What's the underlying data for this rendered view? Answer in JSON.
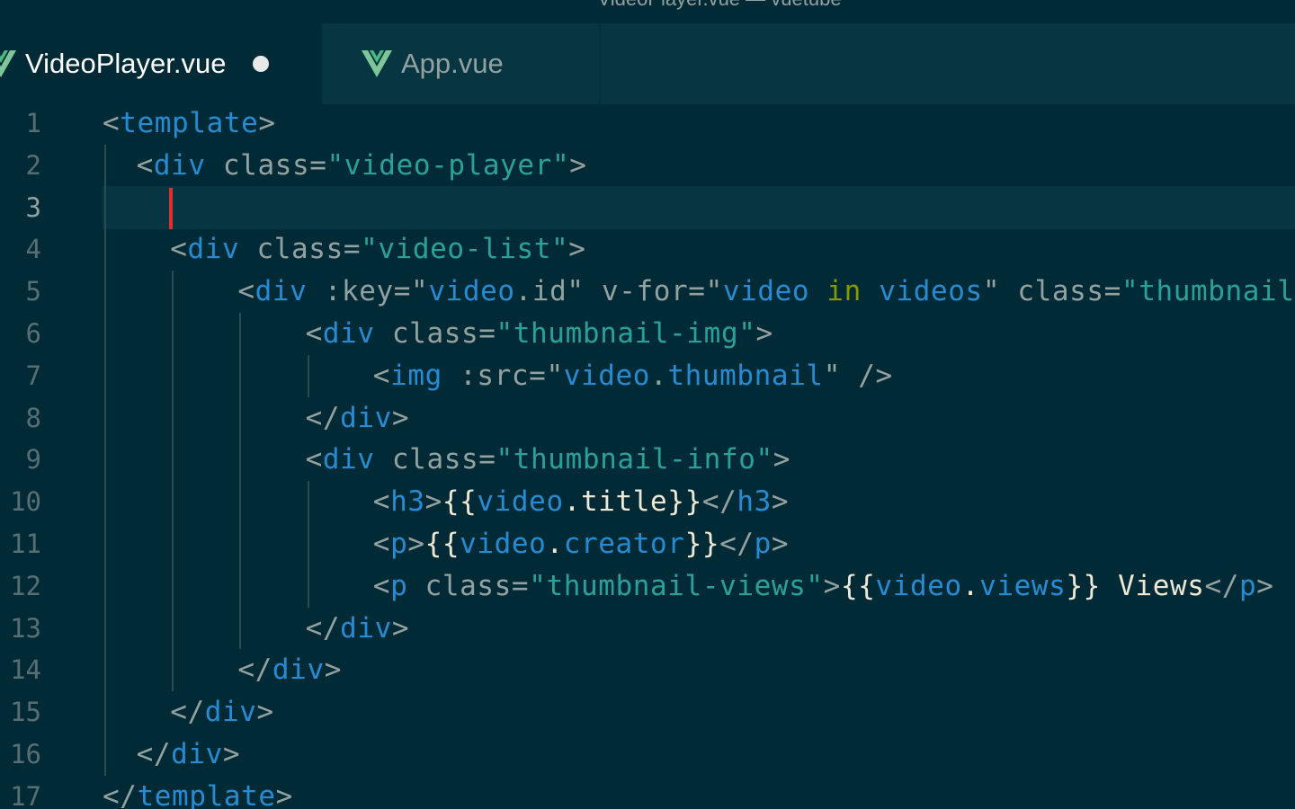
{
  "window": {
    "title": "VideoPlayer.vue — vuetube"
  },
  "tabs": [
    {
      "label": "VideoPlayer.vue",
      "icon": "vue-logo-icon",
      "active": true,
      "modified": true
    },
    {
      "label": "App.vue",
      "icon": "vue-logo-icon",
      "active": false,
      "modified": false
    }
  ],
  "colors": {
    "background": "#002b36",
    "tab_bar": "#073642",
    "current_line": "#073642",
    "cursor": "#dc322f",
    "tag": "#268bd2",
    "string": "#2aa198",
    "keyword": "#859900",
    "punctuation": "#93a1a1",
    "line_number": "#586e75"
  },
  "editor": {
    "current_line": 3,
    "line_numbers": [
      "1",
      "2",
      "3",
      "4",
      "5",
      "6",
      "7",
      "8",
      "9",
      "10",
      "11",
      "12",
      "13",
      "14",
      "15",
      "16",
      "17"
    ],
    "lines": [
      {
        "num": "1",
        "indent": 0,
        "tokens": [
          [
            "punct",
            "<"
          ],
          [
            "tag",
            "template"
          ],
          [
            "punct",
            ">"
          ]
        ]
      },
      {
        "num": "2",
        "indent": 1,
        "tokens": [
          [
            "punct",
            "<"
          ],
          [
            "tag",
            "div"
          ],
          [
            "attr",
            " class="
          ],
          [
            "str",
            "\"video-player\""
          ],
          [
            "punct",
            ">"
          ]
        ]
      },
      {
        "num": "3",
        "indent": 2,
        "tokens": []
      },
      {
        "num": "4",
        "indent": 2,
        "tokens": [
          [
            "punct",
            "<"
          ],
          [
            "tag",
            "div"
          ],
          [
            "attr",
            " class="
          ],
          [
            "str",
            "\"video-list\""
          ],
          [
            "punct",
            ">"
          ]
        ]
      },
      {
        "num": "5",
        "indent": 4,
        "tokens": [
          [
            "punct",
            "<"
          ],
          [
            "tag",
            "div"
          ],
          [
            "attr",
            " :key="
          ],
          [
            "attr",
            "\""
          ],
          [
            "var",
            "video"
          ],
          [
            "attr",
            ".id\""
          ],
          [
            "attr",
            " v-for="
          ],
          [
            "attr",
            "\""
          ],
          [
            "var",
            "video"
          ],
          [
            "kw",
            " in "
          ],
          [
            "var",
            "videos"
          ],
          [
            "attr",
            "\""
          ],
          [
            "attr",
            " class="
          ],
          [
            "str",
            "\"thumbnail\""
          ],
          [
            "punct",
            ">"
          ]
        ]
      },
      {
        "num": "6",
        "indent": 6,
        "tokens": [
          [
            "punct",
            "<"
          ],
          [
            "tag",
            "div"
          ],
          [
            "attr",
            " class="
          ],
          [
            "str",
            "\"thumbnail-img\""
          ],
          [
            "punct",
            ">"
          ]
        ]
      },
      {
        "num": "7",
        "indent": 8,
        "tokens": [
          [
            "punct",
            "<"
          ],
          [
            "tag",
            "img"
          ],
          [
            "attr",
            " :src="
          ],
          [
            "attr",
            "\""
          ],
          [
            "var",
            "video"
          ],
          [
            "attr",
            "."
          ],
          [
            "var",
            "thumbnail"
          ],
          [
            "attr",
            "\""
          ],
          [
            "punct",
            " />"
          ]
        ]
      },
      {
        "num": "8",
        "indent": 6,
        "tokens": [
          [
            "punct",
            "</"
          ],
          [
            "tag",
            "div"
          ],
          [
            "punct",
            ">"
          ]
        ]
      },
      {
        "num": "9",
        "indent": 6,
        "tokens": [
          [
            "punct",
            "<"
          ],
          [
            "tag",
            "div"
          ],
          [
            "attr",
            " class="
          ],
          [
            "str",
            "\"thumbnail-info\""
          ],
          [
            "punct",
            ">"
          ]
        ]
      },
      {
        "num": "10",
        "indent": 8,
        "tokens": [
          [
            "punct",
            "<"
          ],
          [
            "tag",
            "h3"
          ],
          [
            "punct",
            ">"
          ],
          [
            "text",
            "{{"
          ],
          [
            "var",
            "video"
          ],
          [
            "text",
            ".title}}"
          ],
          [
            "punct",
            "</"
          ],
          [
            "tag",
            "h3"
          ],
          [
            "punct",
            ">"
          ]
        ]
      },
      {
        "num": "11",
        "indent": 8,
        "tokens": [
          [
            "punct",
            "<"
          ],
          [
            "tag",
            "p"
          ],
          [
            "punct",
            ">"
          ],
          [
            "text",
            "{{"
          ],
          [
            "var",
            "video"
          ],
          [
            "text",
            "."
          ],
          [
            "var",
            "creator"
          ],
          [
            "text",
            "}}"
          ],
          [
            "punct",
            "</"
          ],
          [
            "tag",
            "p"
          ],
          [
            "punct",
            ">"
          ]
        ]
      },
      {
        "num": "12",
        "indent": 8,
        "tokens": [
          [
            "punct",
            "<"
          ],
          [
            "tag",
            "p"
          ],
          [
            "attr",
            " class="
          ],
          [
            "str",
            "\"thumbnail-views\""
          ],
          [
            "punct",
            ">"
          ],
          [
            "text",
            "{{"
          ],
          [
            "var",
            "video"
          ],
          [
            "text",
            "."
          ],
          [
            "var",
            "views"
          ],
          [
            "text",
            "}} Views"
          ],
          [
            "punct",
            "</"
          ],
          [
            "tag",
            "p"
          ],
          [
            "punct",
            ">"
          ]
        ]
      },
      {
        "num": "13",
        "indent": 6,
        "tokens": [
          [
            "punct",
            "</"
          ],
          [
            "tag",
            "div"
          ],
          [
            "punct",
            ">"
          ]
        ]
      },
      {
        "num": "14",
        "indent": 4,
        "tokens": [
          [
            "punct",
            "</"
          ],
          [
            "tag",
            "div"
          ],
          [
            "punct",
            ">"
          ]
        ]
      },
      {
        "num": "15",
        "indent": 2,
        "tokens": [
          [
            "punct",
            "</"
          ],
          [
            "tag",
            "div"
          ],
          [
            "punct",
            ">"
          ]
        ]
      },
      {
        "num": "16",
        "indent": 1,
        "tokens": [
          [
            "punct",
            "</"
          ],
          [
            "tag",
            "div"
          ],
          [
            "punct",
            ">"
          ]
        ]
      },
      {
        "num": "17",
        "indent": 0,
        "tokens": [
          [
            "punct",
            "</"
          ],
          [
            "tag",
            "template"
          ],
          [
            "punct",
            ">"
          ]
        ]
      }
    ]
  }
}
